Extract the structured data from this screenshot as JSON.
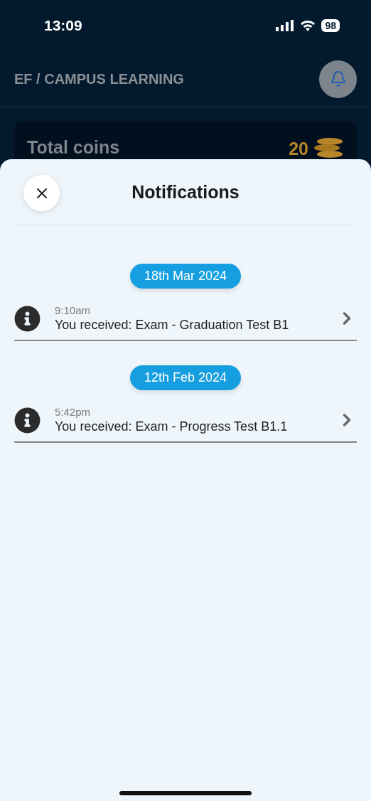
{
  "status_bar": {
    "time": "13:09",
    "battery": "98"
  },
  "header": {
    "title": "EF / CAMPUS LEARNING"
  },
  "coins_card": {
    "label": "Total coins",
    "value": "20"
  },
  "sheet": {
    "title": "Notifications",
    "groups": [
      {
        "date": "18th Mar 2024",
        "items": [
          {
            "time": "9:10am",
            "text": "You received: Exam - Graduation Test B1"
          }
        ]
      },
      {
        "date": "12th Feb 2024",
        "items": [
          {
            "time": "5:42pm",
            "text": "You received: Exam - Progress Test B1.1"
          }
        ]
      }
    ]
  }
}
